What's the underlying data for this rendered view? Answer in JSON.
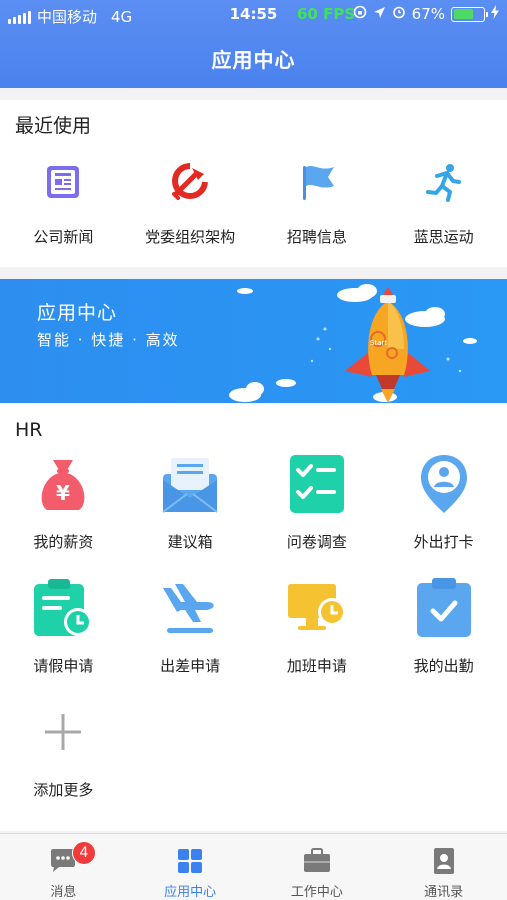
{
  "status": {
    "carrier": "中国移动",
    "network": "4G",
    "time": "14:55",
    "fps": "60 FPS",
    "battery_pct": "67%",
    "battery_level": 0.67
  },
  "header": {
    "title": "应用中心"
  },
  "recent": {
    "title": "最近使用",
    "items": [
      {
        "label": "公司新闻",
        "icon": "newspaper-icon",
        "color": "#7b6cf0"
      },
      {
        "label": "党委组织架构",
        "icon": "hammer-sickle-icon",
        "color": "#e22a22"
      },
      {
        "label": "招聘信息",
        "icon": "flag-icon",
        "color": "#4a90e2"
      },
      {
        "label": "蓝思运动",
        "icon": "runner-icon",
        "color": "#34a6e8"
      }
    ]
  },
  "banner": {
    "title": "应用中心",
    "subtitle": "智能 · 快捷 · 高效",
    "rocket_text": "Start"
  },
  "hr": {
    "title": "HR",
    "items": [
      {
        "label": "我的薪资",
        "icon": "money-bag-icon",
        "color": "#f25c6b"
      },
      {
        "label": "建议箱",
        "icon": "mail-box-icon",
        "color": "#5aa7f0"
      },
      {
        "label": "问卷调查",
        "icon": "checklist-icon",
        "color": "#1fd1a8"
      },
      {
        "label": "外出打卡",
        "icon": "location-pin-icon",
        "color": "#5aa7f0"
      },
      {
        "label": "请假申请",
        "icon": "clipboard-clock-icon",
        "color": "#1fd1a8"
      },
      {
        "label": "出差申请",
        "icon": "airplane-icon",
        "color": "#5aa7f0"
      },
      {
        "label": "加班申请",
        "icon": "monitor-clock-icon",
        "color": "#f5c331"
      },
      {
        "label": "我的出勤",
        "icon": "clipboard-check-icon",
        "color": "#5aa7f0"
      },
      {
        "label": "添加更多",
        "icon": "plus-icon",
        "color": "#9a9a9a"
      }
    ]
  },
  "tabs": [
    {
      "label": "消息",
      "icon": "chat-icon",
      "badge": "4"
    },
    {
      "label": "应用中心",
      "icon": "grid-icon",
      "active": true
    },
    {
      "label": "工作中心",
      "icon": "briefcase-icon"
    },
    {
      "label": "通讯录",
      "icon": "contacts-icon"
    }
  ],
  "colors": {
    "accent": "#3b82f0",
    "header": "#5b8ef2",
    "banner": "#2d8ef0"
  }
}
